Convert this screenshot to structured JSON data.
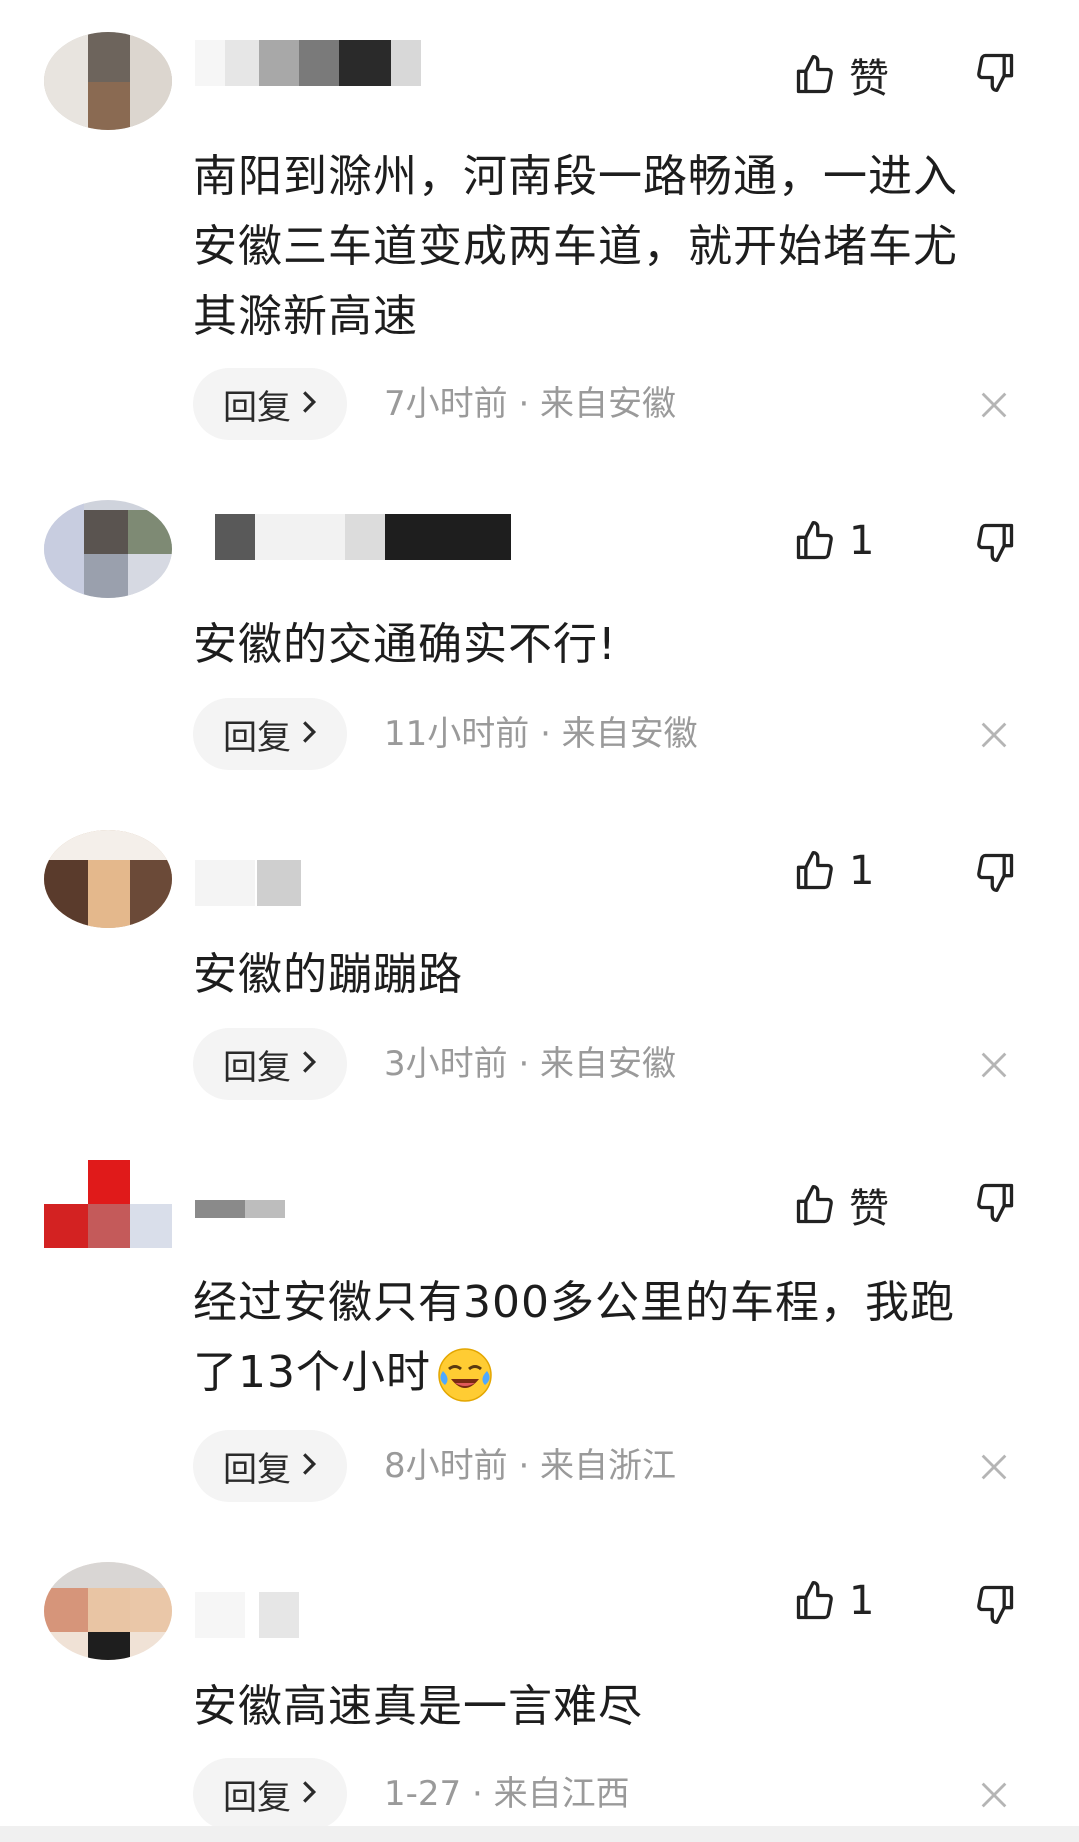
{
  "comments": [
    {
      "like_label": "赞",
      "text_lines": [
        "南阳到滁州，河南段一路畅通，一进入",
        "安徽三车道变成两车道，就开始堵车尤",
        "其滁新高速"
      ],
      "reply_label": "回复",
      "meta": "7小时前 · 来自安徽",
      "emoji": ""
    },
    {
      "like_label": "1",
      "text_lines": [
        "安徽的交通确实不行!"
      ],
      "reply_label": "回复",
      "meta": "11小时前 · 来自安徽",
      "emoji": ""
    },
    {
      "like_label": "1",
      "text_lines": [
        "安徽的蹦蹦路"
      ],
      "reply_label": "回复",
      "meta": "3小时前 · 来自安徽",
      "emoji": ""
    },
    {
      "like_label": "赞",
      "text_lines": [
        "经过安徽只有300多公里的车程，我跑",
        "了13个小时"
      ],
      "reply_label": "回复",
      "meta": "8小时前 · 来自浙江",
      "emoji": "crying-laughing-emoji"
    },
    {
      "like_label": "1",
      "text_lines": [
        "安徽高速真是一言难尽"
      ],
      "reply_label": "回复",
      "meta": "1-27 · 来自江西",
      "emoji": ""
    }
  ],
  "icons": {
    "like": "thumbs-up-icon",
    "dislike": "thumbs-down-icon",
    "reply_arrow": "chevron-right-icon",
    "close": "close-icon"
  },
  "colors": {
    "text": "#1d1d1d",
    "meta": "#9a9a9a",
    "reply_bg": "#f4f4f4"
  }
}
